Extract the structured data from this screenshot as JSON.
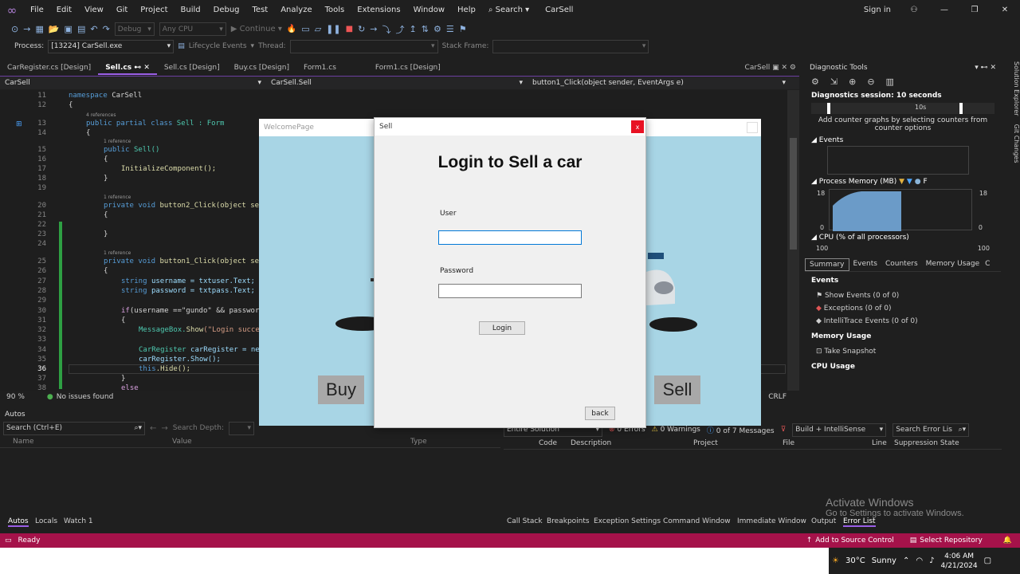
{
  "menu": {
    "items": [
      "File",
      "Edit",
      "View",
      "Git",
      "Project",
      "Build",
      "Debug",
      "Test",
      "Analyze",
      "Tools",
      "Extensions",
      "Window",
      "Help"
    ],
    "search": "Search",
    "title": "CarSell",
    "signin": "Sign in"
  },
  "toolbar": {
    "config": "Debug",
    "platform": "Any CPU",
    "continue": "Continue"
  },
  "process": {
    "label": "Process:",
    "value": "[13224] CarSell.exe",
    "lifecycle": "Lifecycle Events",
    "thread": "Thread:",
    "stackframe": "Stack Frame:"
  },
  "tabs": [
    "CarRegister.cs [Design]",
    "Sell.cs",
    "Sell.cs [Design]",
    "Buy.cs [Design]",
    "Form1.cs",
    "Form1.cs [Design]"
  ],
  "tabs_right": "CarSell",
  "nav": {
    "project": "CarSell",
    "class": "CarSell.Sell",
    "member": "button1_Click(object sender, EventArgs e)"
  },
  "code": {
    "lines": [
      "11",
      "12",
      "13",
      "14",
      "15",
      "16",
      "17",
      "18",
      "19",
      "20",
      "21",
      "22",
      "23",
      "24",
      "25",
      "26",
      "27",
      "28",
      "29",
      "30",
      "31",
      "32",
      "33",
      "34",
      "35",
      "36",
      "37",
      "38"
    ],
    "refs": [
      "4 references",
      "1 reference",
      "1 reference",
      "1 reference"
    ],
    "l_ns": "namespace",
    "l_ns_name": "CarSell",
    "l_pub": "public partial class",
    "l_cls": "Sell",
    "l_base": ": Form",
    "l_ctor": "public",
    "l_ctor_name": "Sell()",
    "l_init": "InitializeComponent();",
    "l_b2": "private void",
    "l_b2_name": "button2_Click(object se",
    "l_b1": "private void",
    "l_b1_name": "button1_Click(object se",
    "l_s1": "string",
    "l_s1_rest": "username = txtuser.Text;",
    "l_s2": "string",
    "l_s2_rest": "password = txtpass.Text;",
    "l_if": "if",
    "l_if_rest": "(username ==\"gundo\" && passwor",
    "l_msg": "MessageBox.",
    "l_msg_fn": "Show",
    "l_msg_rest": "(\"Login succe",
    "l_cr": "CarRegister",
    "l_cr_rest": "carRegister = ne",
    "l_crshow": "carRegister.Show();",
    "l_this": "this",
    "l_hide": ".Hide();",
    "l_else": "else",
    "brace_open": "{",
    "brace_close": "}"
  },
  "editor_status": {
    "zoom": "90 %",
    "issues": "No issues found",
    "crlf": "CRLF",
    "ln": "C"
  },
  "diag": {
    "title": "Diagnostic Tools",
    "session": "Diagnostics session: 10 seconds",
    "tick": "10s",
    "counter_msg": "Add counter graphs by selecting counters from counter options",
    "events": "Events",
    "mem": "Process Memory (MB)",
    "mem_max": "18",
    "mem_min": "0",
    "mem_legend": "F",
    "cpu": "CPU (% of all processors)",
    "cpu_max": "100",
    "tabs": [
      "Summary",
      "Events",
      "Counters",
      "Memory Usage",
      "C"
    ],
    "sec_events": "Events",
    "show_events": "Show Events (0 of 0)",
    "exceptions": "Exceptions (0 of 0)",
    "intellitrace": "IntelliTrace Events (0 of 0)",
    "sec_mem": "Memory Usage",
    "snapshot": "Take Snapshot",
    "sec_cpu": "CPU Usage"
  },
  "autos": {
    "title": "Autos",
    "search": "Search (Ctrl+E)",
    "depth": "Search Depth:",
    "cols": [
      "Name",
      "Value",
      "Type"
    ]
  },
  "errors": {
    "scope": "Entire Solution",
    "errors": "0 Errors",
    "warnings": "0 Warnings",
    "messages": "0 of 7 Messages",
    "build": "Build + IntelliSense",
    "search": "Search Error Lis",
    "cols": [
      "Code",
      "Description",
      "Project",
      "File",
      "Line",
      "Suppression State"
    ]
  },
  "bottomtabs_left": [
    "Autos",
    "Locals",
    "Watch 1"
  ],
  "bottomtabs_right": [
    "Call Stack",
    "Breakpoints",
    "Exception Settings",
    "Command Window",
    "Immediate Window",
    "Output",
    "Error List"
  ],
  "activate": {
    "title": "Activate Windows",
    "sub": "Go to Settings to activate Windows."
  },
  "status": {
    "ready": "Ready",
    "source": "Add to Source Control",
    "repo": "Select Repository"
  },
  "taskbar": {
    "weather": "30°C",
    "cond": "Sunny",
    "time": "4:06 AM",
    "date": "4/21/2024"
  },
  "welcome": {
    "title": "WelcomePage",
    "buy": "Buy",
    "sell": "Sell"
  },
  "sell": {
    "title": "Sell",
    "heading": "Login to Sell a car",
    "user": "User",
    "password": "Password",
    "login": "Login",
    "back": "back",
    "close": "x"
  }
}
